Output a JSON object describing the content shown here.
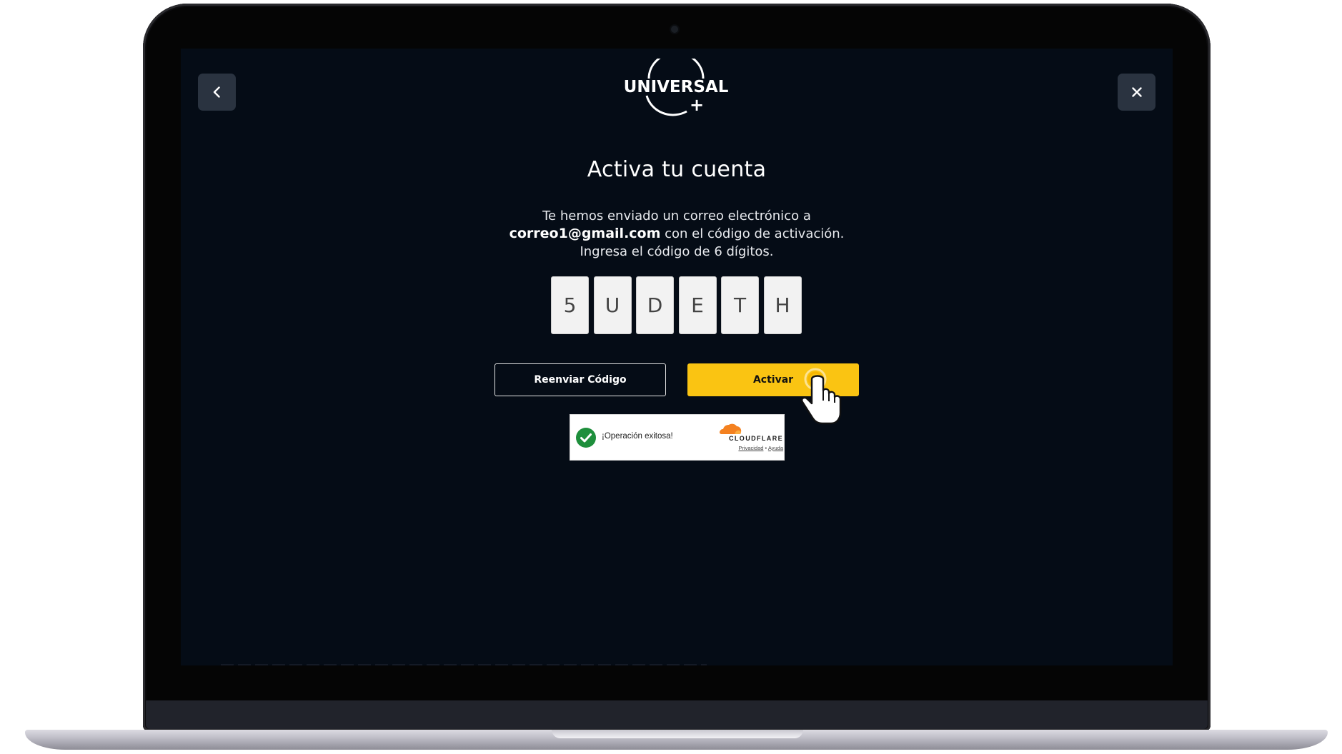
{
  "header": {
    "back_icon": "chevron-left-icon",
    "close_icon": "close-icon",
    "logo_text": "UNIVERSAL",
    "logo_plus": "+"
  },
  "activation": {
    "title": "Activa tu cuenta",
    "line1": "Te hemos enviado un correo electrónico a",
    "email": "correo1@gmail.com",
    "line2_suffix": " con el código de activación.",
    "line3": "Ingresa el código de 6 dígitos.",
    "code": [
      "5",
      "U",
      "D",
      "E",
      "T",
      "H"
    ]
  },
  "buttons": {
    "resend_label": "Reenviar Código",
    "activate_label": "Activar"
  },
  "captcha": {
    "status_text": "¡Operación exitosa!",
    "brand": "CLOUDFLARE",
    "privacy_link": "Privacidad",
    "separator": "•",
    "help_link": "Ayuda"
  },
  "colors": {
    "screen_bg": "#050c16",
    "accent_yellow": "#fac412",
    "nav_button_bg": "#2a3340",
    "success_green": "#1e8f3c",
    "cloudflare_orange": "#f48120"
  }
}
